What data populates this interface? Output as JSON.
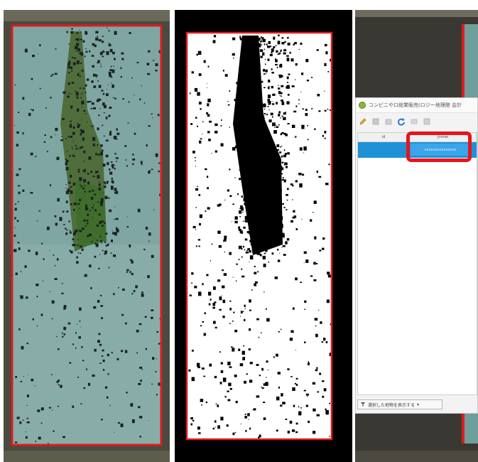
{
  "qgis_window": {
    "title": "コンビニやロ総業販売(ロジー地理館 会計",
    "columns": [
      "id",
      "jinmei"
    ],
    "selected_cell": "xxxxxxxxxxxxxxx",
    "show_selected_button": "選択した地物を表示する"
  },
  "colors": {
    "border_red": "#e01b1b",
    "selection_blue": "#1f92d6",
    "highlight_red": "#e8141a"
  },
  "icons": [
    "pencil-icon",
    "save-icon",
    "refresh-icon",
    "filter-icon",
    "qgis-logo-icon"
  ]
}
